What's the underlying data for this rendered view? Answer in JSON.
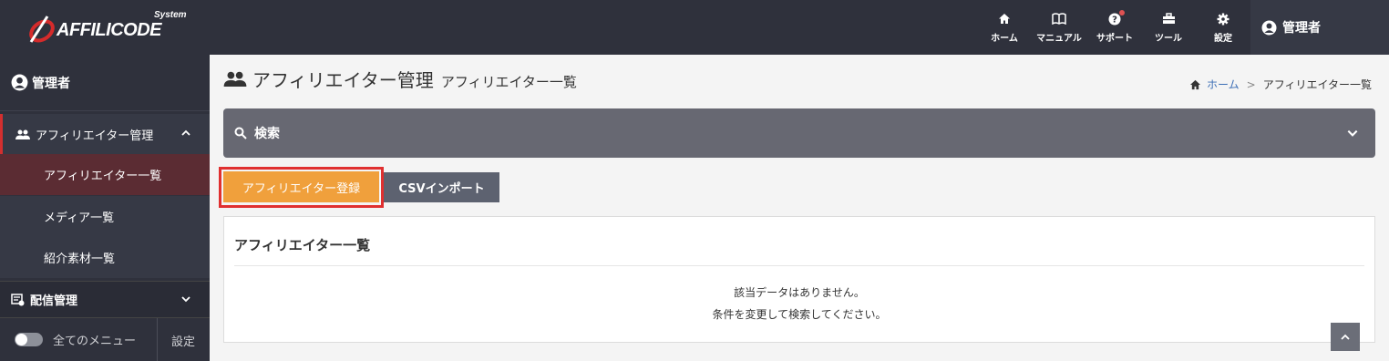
{
  "brand": {
    "name": "AFFILICODE",
    "sub": "System"
  },
  "topnav": [
    {
      "icon": "home-icon",
      "label": "ホーム"
    },
    {
      "icon": "book-icon",
      "label": "マニュアル"
    },
    {
      "icon": "help-icon",
      "label": "サポート"
    },
    {
      "icon": "toolbox-icon",
      "label": "ツール"
    },
    {
      "icon": "gear-icon",
      "label": "設定"
    }
  ],
  "user": {
    "name": "管理者"
  },
  "sidebar": {
    "user": "管理者",
    "section": "アフィリエイター管理",
    "items": [
      "アフィリエイター一覧",
      "メディア一覧",
      "紹介素材一覧"
    ],
    "delivery": "配信管理",
    "all_menu": "全てのメニュー",
    "settings": "設定"
  },
  "page": {
    "title": "アフィリエイター管理",
    "subtitle": "アフィリエイター一覧",
    "breadcrumb": {
      "home": "ホーム",
      "sep": ">",
      "current": "アフィリエイター一覧"
    }
  },
  "search": {
    "label": "検索"
  },
  "buttons": {
    "register": "アフィリエイター登録",
    "csv_import": "CSVインポート"
  },
  "card": {
    "title": "アフィリエイター一覧",
    "empty_line1": "該当データはありません。",
    "empty_line2": "条件を変更して検索してください。"
  }
}
